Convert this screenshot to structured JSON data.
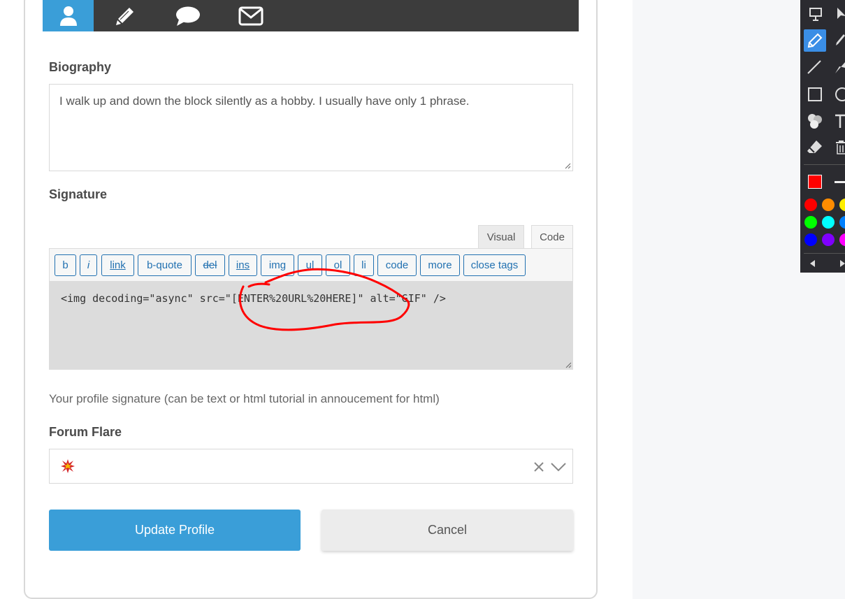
{
  "tabs": [
    {
      "icon": "user-icon",
      "active": true
    },
    {
      "icon": "pencil-icon",
      "active": false
    },
    {
      "icon": "speech-bubble-icon",
      "active": false
    },
    {
      "icon": "envelope-icon",
      "active": false
    }
  ],
  "biography": {
    "label": "Biography",
    "value": "I walk up and down the block silently as a hobby. I usually have only 1 phrase."
  },
  "signature": {
    "label": "Signature",
    "editor_tabs": {
      "visual": "Visual",
      "code": "Code"
    },
    "quicktags": [
      "b",
      "i",
      "link",
      "b-quote",
      "del",
      "ins",
      "img",
      "ul",
      "ol",
      "li",
      "code",
      "more",
      "close tags"
    ],
    "code_value": "<img decoding=\"async\" src=\"[ENTER%20URL%20HERE]\" alt=\"GIF\" />",
    "hint": "Your profile signature (can be text or html tutorial in annoucement for html)"
  },
  "forum_flare": {
    "label": "Forum Flare",
    "selected_icon": "explosion-icon"
  },
  "buttons": {
    "update": "Update Profile",
    "cancel": "Cancel"
  },
  "annotation_toolbar": {
    "current_color": "#ff0000",
    "palette": [
      "#ff0000",
      "#ff8c00",
      "#ffee00",
      "#00ff00",
      "#00ffff",
      "#0080ff",
      "#0000ff",
      "#8000ff",
      "#ff00ff"
    ]
  },
  "colors": {
    "accent": "#3a9ed8",
    "tab_bar": "#3c3c3c",
    "link": "#2271b1",
    "annotation": "#ff0000"
  }
}
